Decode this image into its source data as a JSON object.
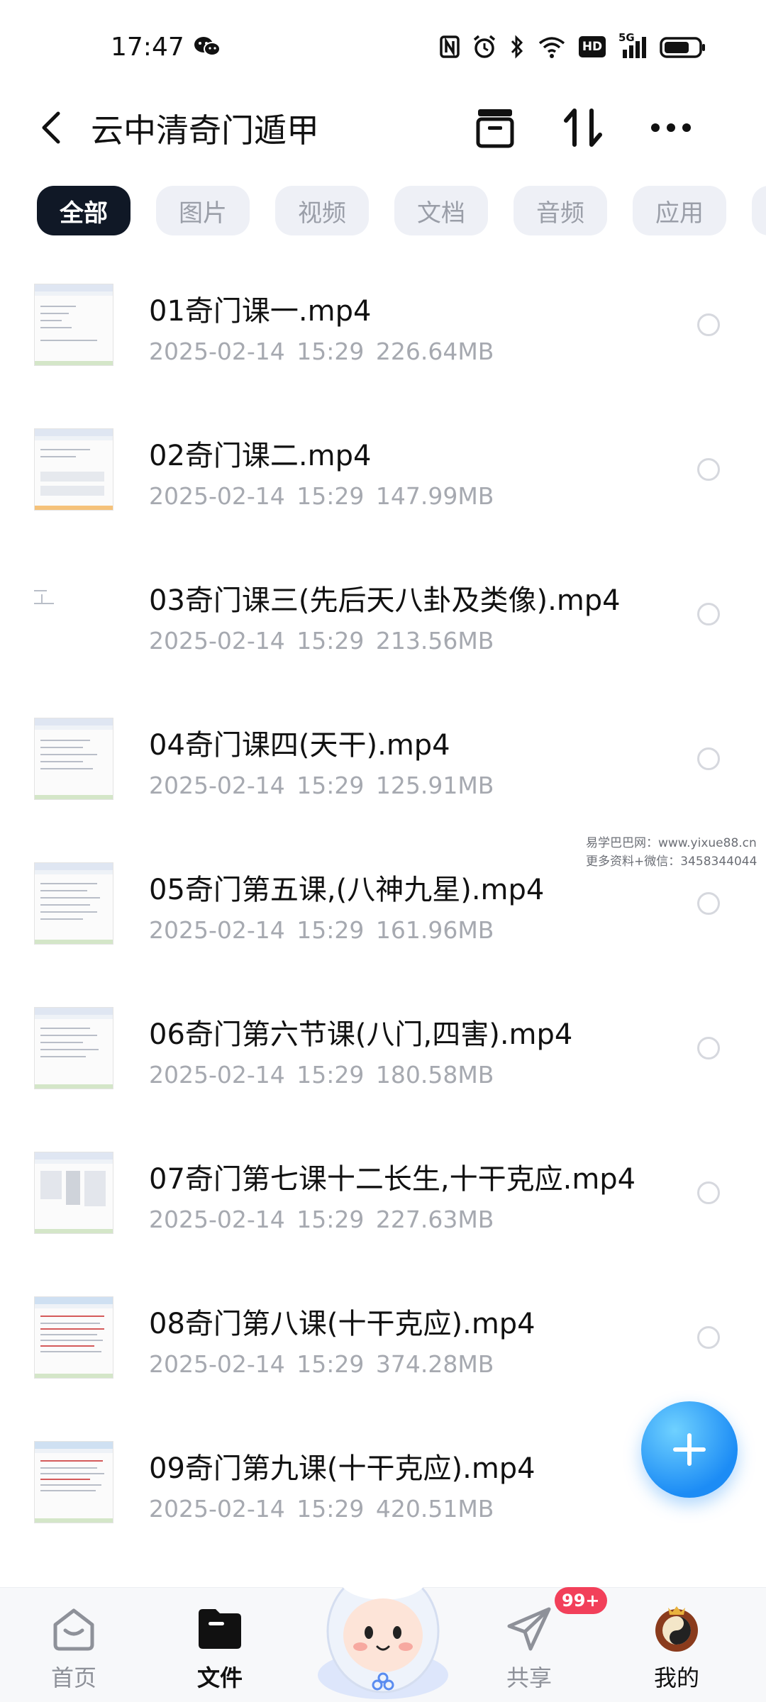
{
  "status_bar": {
    "time": "17:47",
    "network_label": "5G",
    "hd_label": "HD",
    "icons": [
      "wechat-icon",
      "nfc-icon",
      "alarm-icon",
      "bluetooth-icon",
      "wifi-icon",
      "hd-icon",
      "signal-icon",
      "battery-icon"
    ]
  },
  "header": {
    "title": "云中清奇门遁甲",
    "icons": [
      "back-icon",
      "archive-icon",
      "sort-icon",
      "more-icon"
    ]
  },
  "filters": [
    {
      "label": "全部",
      "active": true
    },
    {
      "label": "图片",
      "active": false
    },
    {
      "label": "视频",
      "active": false
    },
    {
      "label": "文档",
      "active": false
    },
    {
      "label": "音频",
      "active": false
    },
    {
      "label": "应用",
      "active": false
    }
  ],
  "files": [
    {
      "name": "01奇门课一.mp4",
      "meta": "2025-02-14  15:29  226.64MB"
    },
    {
      "name": "02奇门课二.mp4",
      "meta": "2025-02-14  15:29  147.99MB"
    },
    {
      "name": "03奇门课三(先后天八卦及类像).mp4",
      "meta": "2025-02-14  15:29  213.56MB"
    },
    {
      "name": "04奇门课四(天干).mp4",
      "meta": "2025-02-14  15:29  125.91MB"
    },
    {
      "name": "05奇门第五课,(八神九星).mp4",
      "meta": "2025-02-14  15:29  161.96MB"
    },
    {
      "name": "06奇门第六节课(八门,四害).mp4",
      "meta": "2025-02-14  15:29  180.58MB"
    },
    {
      "name": "07奇门第七课十二长生,十干克应.mp4",
      "meta": "2025-02-14  15:29  227.63MB"
    },
    {
      "name": "08奇门第八课(十干克应).mp4",
      "meta": "2025-02-14  15:29  374.28MB"
    },
    {
      "name": "09奇门第九课(十干克应).mp4",
      "meta": "2025-02-14  15:29  420.51MB"
    }
  ],
  "watermark": {
    "line1": "易学巴巴网：www.yixue88.cn",
    "line2": "更多资料+微信：3458344044"
  },
  "bottom_nav": {
    "items": [
      {
        "label": "首页",
        "icon": "home-icon",
        "active": false
      },
      {
        "label": "文件",
        "icon": "folder-icon",
        "active": true
      },
      {
        "label": "共享",
        "icon": "paper-plane-icon",
        "active": false
      },
      {
        "label": "我的",
        "icon": "avatar-icon",
        "active": false
      }
    ],
    "share_badge": "99+",
    "center_icon": "mascot-icon"
  },
  "colors": {
    "active_chip": "#101826",
    "chip_bg": "#eef0f6",
    "fab": "#1c8cf5",
    "badge": "#f2405a"
  }
}
